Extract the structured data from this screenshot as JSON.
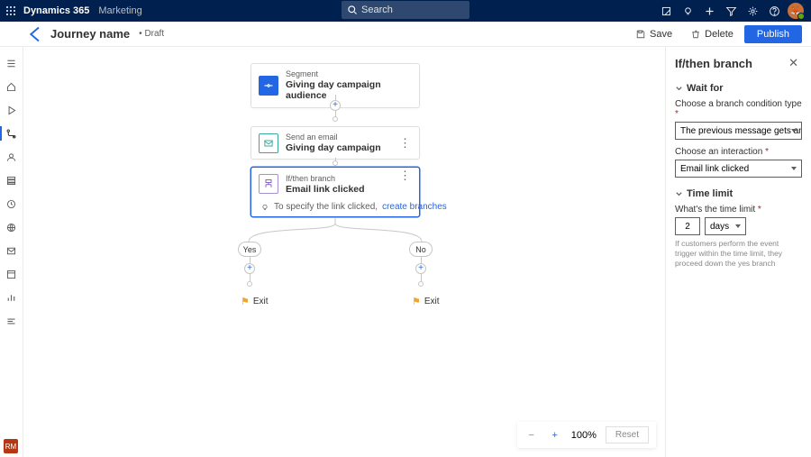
{
  "topbar": {
    "brand": "Dynamics 365",
    "area": "Marketing",
    "search_placeholder": "Search"
  },
  "header": {
    "title": "Journey name",
    "status": "Draft",
    "save_label": "Save",
    "delete_label": "Delete",
    "publish_label": "Publish"
  },
  "canvas": {
    "node1": {
      "type": "Segment",
      "title": "Giving day campaign audience"
    },
    "node2": {
      "type": "Send an email",
      "title": "Giving day campaign"
    },
    "node3": {
      "type": "If/then branch",
      "title": "Email link clicked"
    },
    "hint_prefix": "To specify the link clicked, ",
    "hint_link": "create branches",
    "yes": "Yes",
    "no": "No",
    "exit": "Exit"
  },
  "zoom": {
    "value": "100%",
    "reset": "Reset"
  },
  "panel": {
    "title": "If/then branch",
    "sect1": "Wait for",
    "cond_label": "Choose a branch condition type",
    "cond_value": "The previous message gets an interaction",
    "inter_label": "Choose an interaction",
    "inter_value": "Email link clicked",
    "sect2": "Time limit",
    "time_label": "What's the time limit",
    "time_value": "2",
    "time_unit": "days",
    "help": "If customers perform the event trigger within the time limit, they proceed down the yes branch"
  },
  "rm": "RM"
}
